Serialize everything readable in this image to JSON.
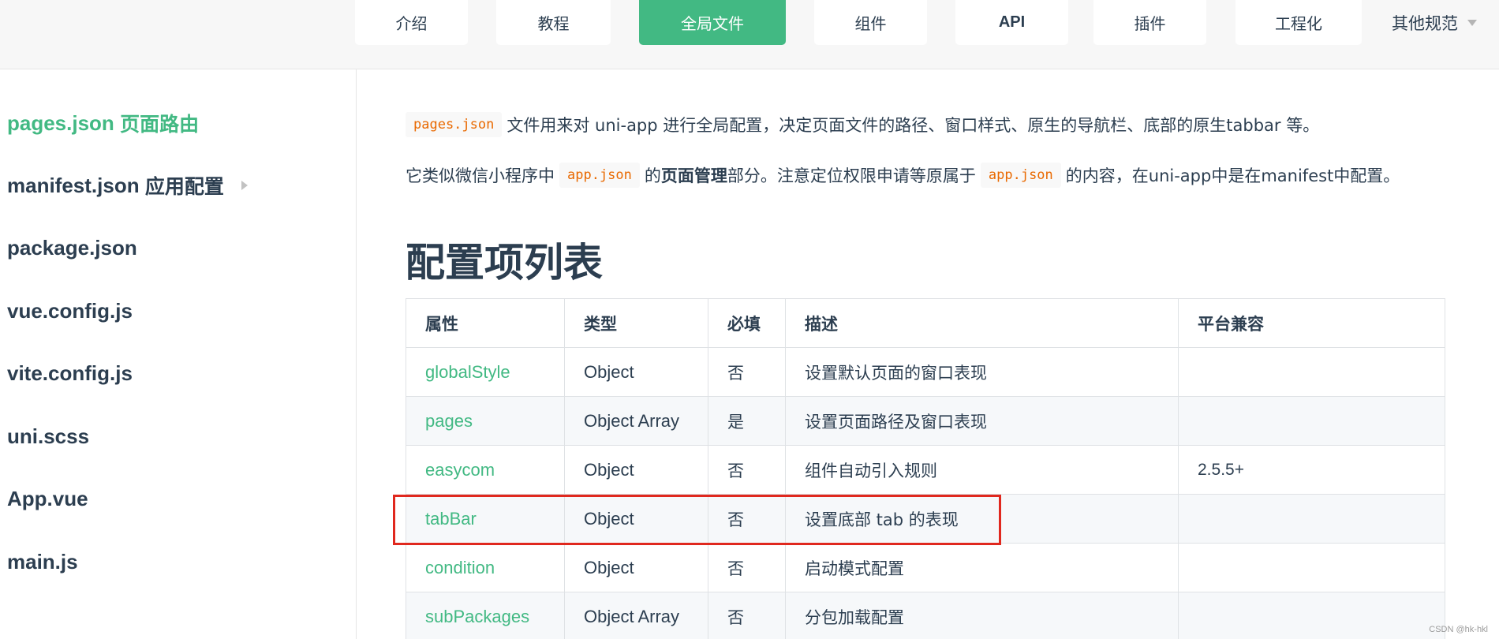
{
  "nav": {
    "tabs": [
      {
        "label": "介绍"
      },
      {
        "label": "教程"
      },
      {
        "label": "全局文件",
        "active": true
      },
      {
        "label": "组件"
      },
      {
        "label": "API"
      },
      {
        "label": "插件"
      },
      {
        "label": "工程化"
      }
    ],
    "more_label": "其他规范",
    "accent_color": "#42b983"
  },
  "sidebar": {
    "items": [
      {
        "label": "pages.json",
        "label_zh": "页面路由",
        "active": true
      },
      {
        "label": "manifest.json",
        "label_zh": "应用配置",
        "has_children": true
      },
      {
        "label": "package.json"
      },
      {
        "label": "vue.config.js"
      },
      {
        "label": "vite.config.js"
      },
      {
        "label": "uni.scss"
      },
      {
        "label": "App.vue"
      },
      {
        "label": "main.js"
      }
    ]
  },
  "content": {
    "para1": {
      "code": "pages.json",
      "text": "文件用来对 uni-app 进行全局配置，决定页面文件的路径、窗口样式、原生的导航栏、底部的原生tabbar 等。"
    },
    "para2": {
      "t1": "它类似微信小程序中",
      "code1": "app.json",
      "t2": "的",
      "bold": "页面管理",
      "t3": "部分。注意定位权限申请等原属于",
      "code2": "app.json",
      "t4": "的内容，在uni-app中是在manifest中配置。"
    },
    "heading": "配置项列表",
    "table": {
      "headers": [
        "属性",
        "类型",
        "必填",
        "描述",
        "平台兼容"
      ],
      "rows": [
        {
          "attr": "globalStyle",
          "type": "Object",
          "required": "否",
          "desc": "设置默认页面的窗口表现",
          "compat": ""
        },
        {
          "attr": "pages",
          "type": "Object Array",
          "required": "是",
          "desc": "设置页面路径及窗口表现",
          "compat": ""
        },
        {
          "attr": "easycom",
          "type": "Object",
          "required": "否",
          "desc": "组件自动引入规则",
          "compat": "2.5.5+"
        },
        {
          "attr": "tabBar",
          "type": "Object",
          "required": "否",
          "desc": "设置底部 tab 的表现",
          "compat": ""
        },
        {
          "attr": "condition",
          "type": "Object",
          "required": "否",
          "desc": "启动模式配置",
          "compat": ""
        },
        {
          "attr": "subPackages",
          "type": "Object Array",
          "required": "否",
          "desc": "分包加载配置",
          "compat": ""
        }
      ]
    },
    "highlight_color": "#e0281e"
  },
  "watermark": "CSDN @hk-hkl"
}
